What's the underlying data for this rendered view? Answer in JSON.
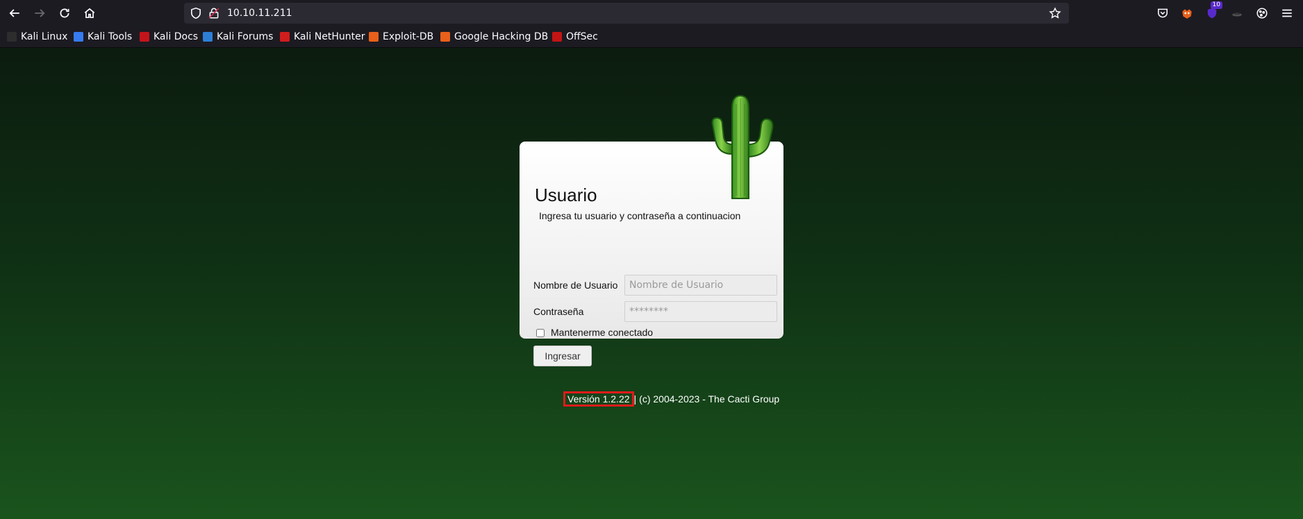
{
  "browser": {
    "url": "10.10.11.211",
    "toolbar_icons": [
      "back-icon",
      "forward-icon",
      "reload-icon",
      "home-icon",
      "shield-icon",
      "lock-icon",
      "star-icon",
      "pocket-icon",
      "extension-icon",
      "extension-icon",
      "extension-icon",
      "extension-icon",
      "menu-icon"
    ],
    "extension_badge": "10"
  },
  "bookmarks": [
    {
      "label": "Kali Linux",
      "color": "#2d2d2d"
    },
    {
      "label": "Kali Tools",
      "color": "#367bf0"
    },
    {
      "label": "Kali Docs",
      "color": "#c4141b"
    },
    {
      "label": "Kali Forums",
      "color": "#2d7fd6"
    },
    {
      "label": "Kali NetHunter",
      "color": "#d11d1d"
    },
    {
      "label": "Exploit-DB",
      "color": "#e8601a"
    },
    {
      "label": "Google Hacking DB",
      "color": "#e8601a"
    },
    {
      "label": "OffSec",
      "color": "#c41414"
    }
  ],
  "login": {
    "title": "Usuario",
    "subtitle": "Ingresa tu usuario y contraseña a continuacion",
    "username_label": "Nombre de Usuario",
    "username_placeholder": "Nombre de Usuario",
    "password_label": "Contraseña",
    "password_placeholder": "********",
    "remember_label": "Mantenerme conectado",
    "submit_label": "Ingresar"
  },
  "footer": {
    "version": "Versión 1.2.22",
    "separator": "|",
    "copyright": "(c) 2004-2023 - The Cacti Group"
  },
  "colors": {
    "chrome": "#1c1b22",
    "urlbar": "#2b2a33",
    "highlight": "#e01b1b"
  }
}
